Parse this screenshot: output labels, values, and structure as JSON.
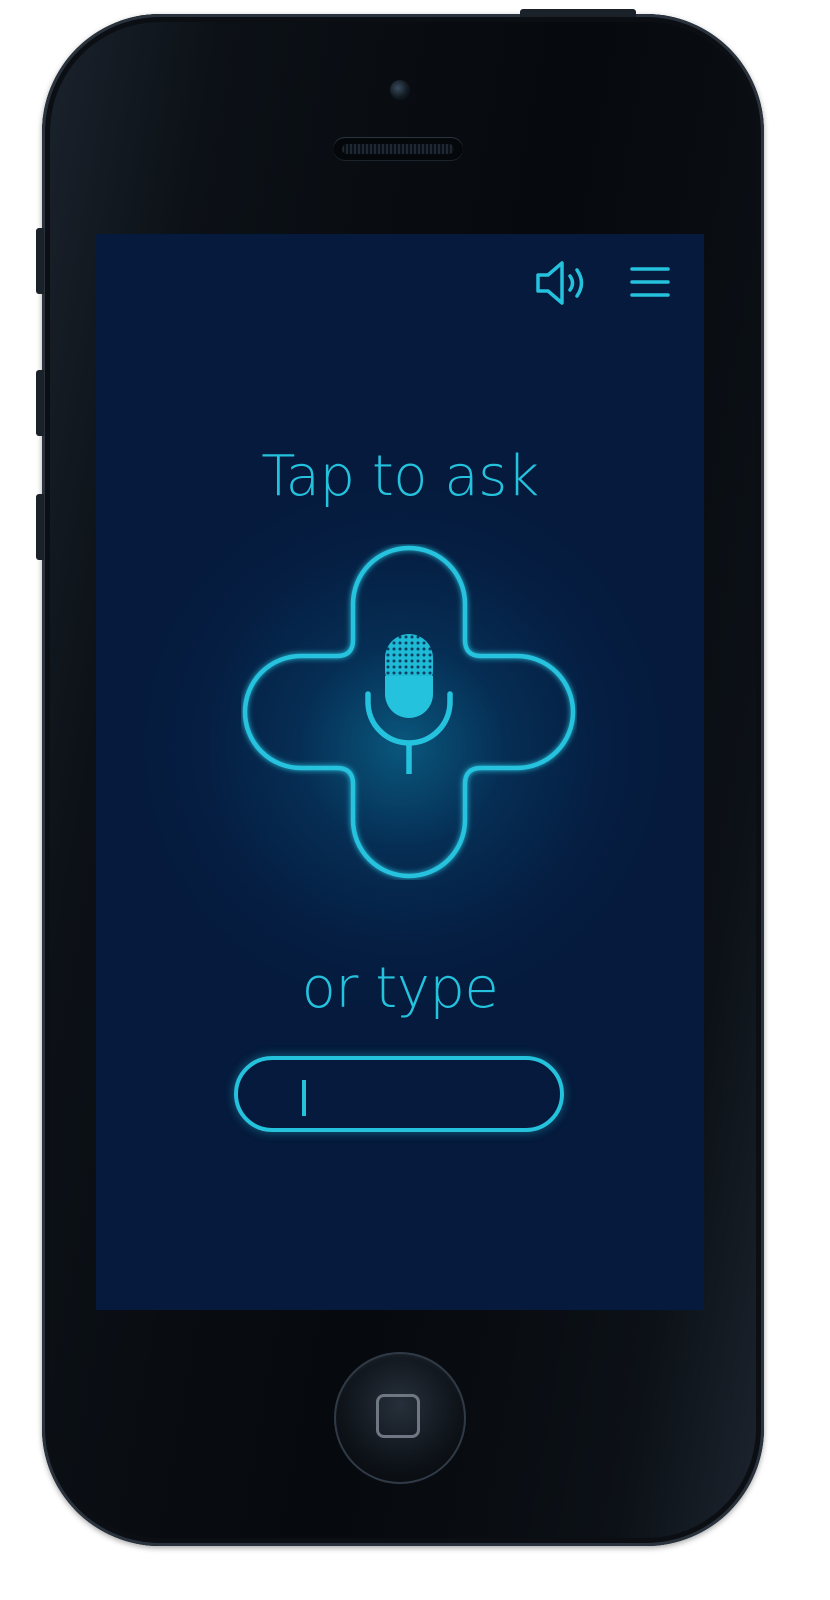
{
  "screen": {
    "prompt_text": "Tap to ask",
    "alt_text": "or type",
    "input_value": "",
    "input_placeholder": ""
  },
  "icons": {
    "sound": "speaker-icon",
    "menu": "hamburger-menu-icon",
    "mic": "microphone-icon"
  },
  "colors": {
    "accent": "#25c2de",
    "screen_background": "#051a3c",
    "device_body": "#0a0f14"
  }
}
